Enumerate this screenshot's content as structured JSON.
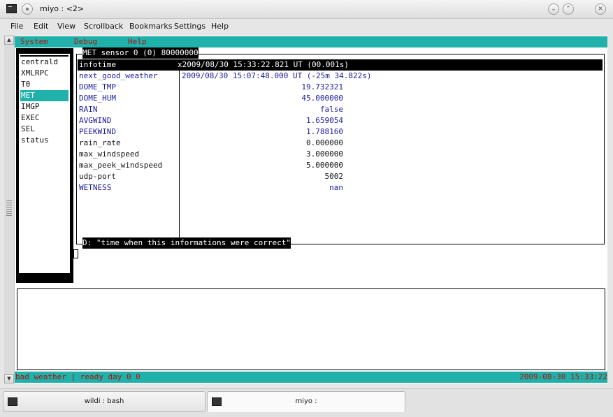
{
  "window": {
    "title": "miyo : <2>",
    "buttons": {
      "minimize": "⌄",
      "maximize": "⌃",
      "close": "✕"
    }
  },
  "menubar": {
    "items": [
      "File",
      "Edit",
      "View",
      "Scrollback",
      "Bookmarks",
      "Settings",
      "Help"
    ]
  },
  "terminal": {
    "top_menu": [
      "System",
      "Debug",
      "Help"
    ],
    "device_list": [
      "centrald",
      "XMLRPC",
      "T0",
      "MET",
      "IMGP",
      "EXEC",
      "SEL",
      "status"
    ],
    "selected_device": "MET",
    "device_title": "MET sensor 0 (0) 80000000",
    "rows": [
      {
        "name": "infotime",
        "value": "x2009/08/30 15:33:22.821 UT (00.001s)",
        "align": "left",
        "style": "selected"
      },
      {
        "name": "next_good_weather",
        "value": "2009/08/30 15:07:48.000 UT (-25m 34.822s)",
        "align": "left",
        "style": "blue"
      },
      {
        "name": "DOME_TMP",
        "value": "19.732321",
        "align": "right",
        "style": "blue"
      },
      {
        "name": "DOME_HUM",
        "value": "45.000000",
        "align": "right",
        "style": "blue"
      },
      {
        "name": "RAIN",
        "value": "false",
        "align": "right",
        "style": "blue"
      },
      {
        "name": "AVGWIND",
        "value": "1.659054",
        "align": "right",
        "style": "blue"
      },
      {
        "name": "PEEKWIND",
        "value": "1.788160",
        "align": "right",
        "style": "blue"
      },
      {
        "name": "rain_rate",
        "value": "0.000000",
        "align": "right",
        "style": "black"
      },
      {
        "name": "max_windspeed",
        "value": "3.000000",
        "align": "right",
        "style": "black"
      },
      {
        "name": "max_peek_windspeed",
        "value": "5.000000",
        "align": "right",
        "style": "black"
      },
      {
        "name": "udp-port",
        "value": "5002",
        "align": "right",
        "style": "black"
      },
      {
        "name": "WETNESS",
        "value": "nan",
        "align": "right",
        "style": "blue"
      }
    ],
    "description": "D: \"time when this informations were correct\"",
    "status_left": "bad weather | ready day 0 0",
    "status_right": "2009-08-30 15:33:22"
  },
  "scrollbar": {
    "up": "▲",
    "down": "▼"
  },
  "taskbar": {
    "tabs": [
      {
        "label": "wildi : bash",
        "active": false
      },
      {
        "label": "miyo :",
        "active": true
      }
    ]
  },
  "colors": {
    "teal": "#20b2aa",
    "menu_text": "#b01010",
    "value_blue": "#1a1aa0"
  }
}
